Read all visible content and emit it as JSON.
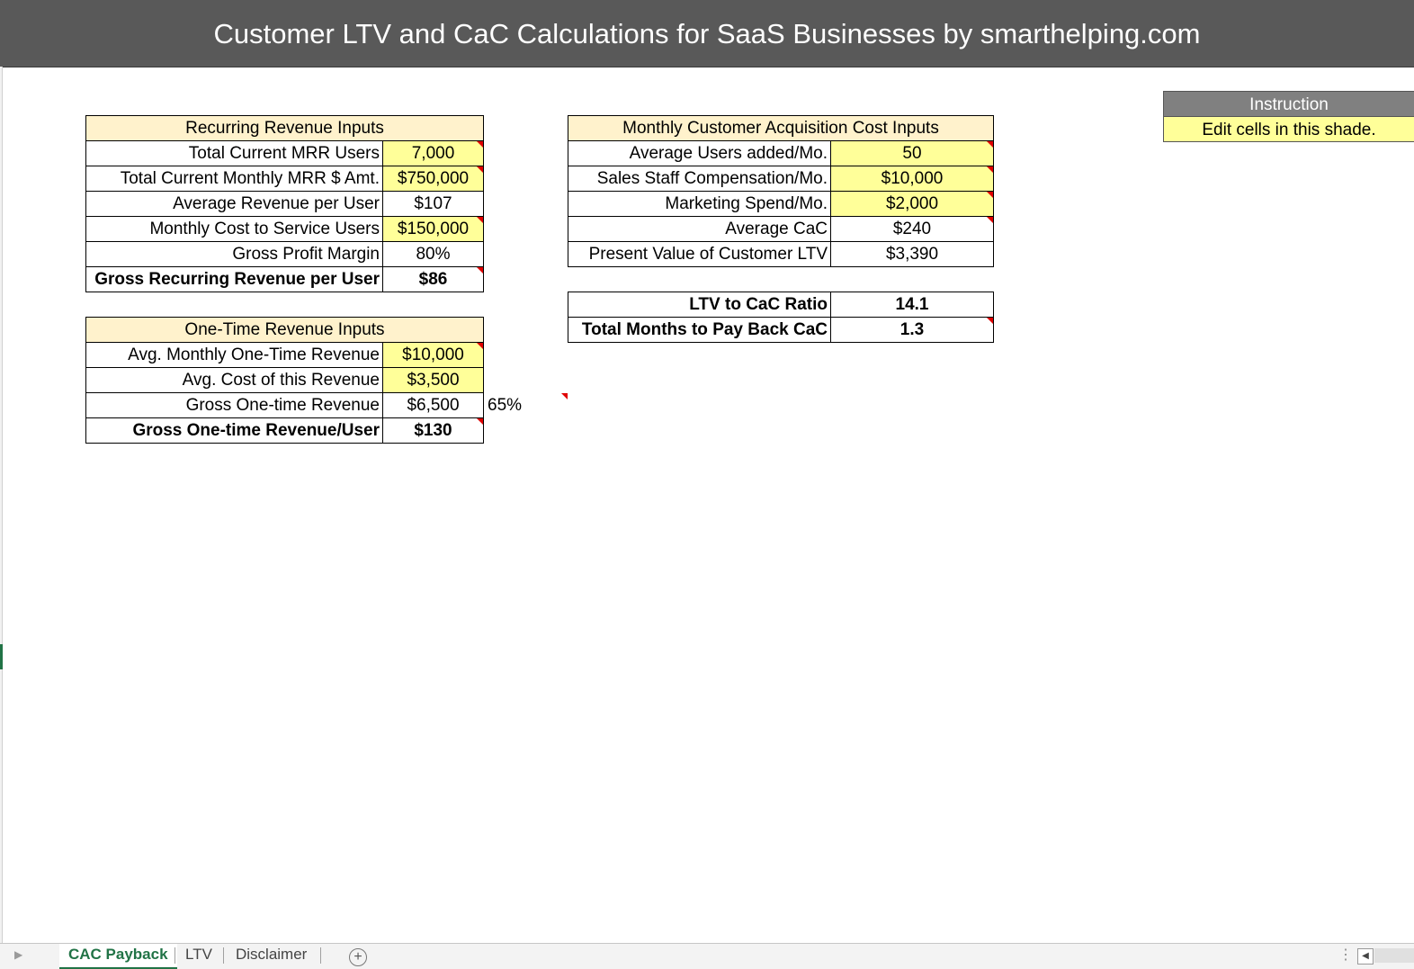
{
  "title": "Customer LTV and CaC Calculations for SaaS Businesses by smarthelping.com",
  "instruction": {
    "header": "Instruction",
    "body": "Edit cells in this shade."
  },
  "recurring": {
    "header": "Recurring Revenue Inputs",
    "rows": [
      {
        "label": "Total Current MRR Users",
        "value": "7,000"
      },
      {
        "label": "Total Current Monthly MRR $ Amt.",
        "value": "$750,000"
      },
      {
        "label": "Average Revenue per User",
        "value": "$107"
      },
      {
        "label": "Monthly Cost to Service Users",
        "value": "$150,000"
      },
      {
        "label": "Gross Profit Margin",
        "value": "80%"
      },
      {
        "label": "Gross Recurring Revenue per User",
        "value": "$86"
      }
    ]
  },
  "onetime": {
    "header": "One-Time Revenue Inputs",
    "rows": [
      {
        "label": "Avg. Monthly One-Time Revenue",
        "value": "$10,000"
      },
      {
        "label": "Avg. Cost of this Revenue",
        "value": "$3,500"
      },
      {
        "label": "Gross One-time Revenue",
        "value": "$6,500"
      },
      {
        "label": "Gross One-time Revenue/User",
        "value": "$130"
      }
    ],
    "side_percent": "65%"
  },
  "cac": {
    "header": "Monthly Customer Acquisition Cost Inputs",
    "rows": [
      {
        "label": "Average Users added/Mo.",
        "value": "50"
      },
      {
        "label": "Sales Staff Compensation/Mo.",
        "value": "$10,000"
      },
      {
        "label": "Marketing Spend/Mo.",
        "value": "$2,000"
      },
      {
        "label": "Average CaC",
        "value": "$240"
      },
      {
        "label": "Present Value of Customer LTV",
        "value": "$3,390"
      }
    ]
  },
  "summary": {
    "rows": [
      {
        "label": "LTV to CaC Ratio",
        "value": "14.1"
      },
      {
        "label": "Total Months to Pay Back CaC",
        "value": "1.3"
      }
    ]
  },
  "colors": {
    "header_bar": "#595959",
    "input_shade": "#ffff99",
    "section_header": "#fff2cc",
    "active_tab": "#217346"
  },
  "tabs": [
    "CAC Payback",
    "LTV",
    "Disclaimer"
  ],
  "active_tab": "CAC Payback"
}
